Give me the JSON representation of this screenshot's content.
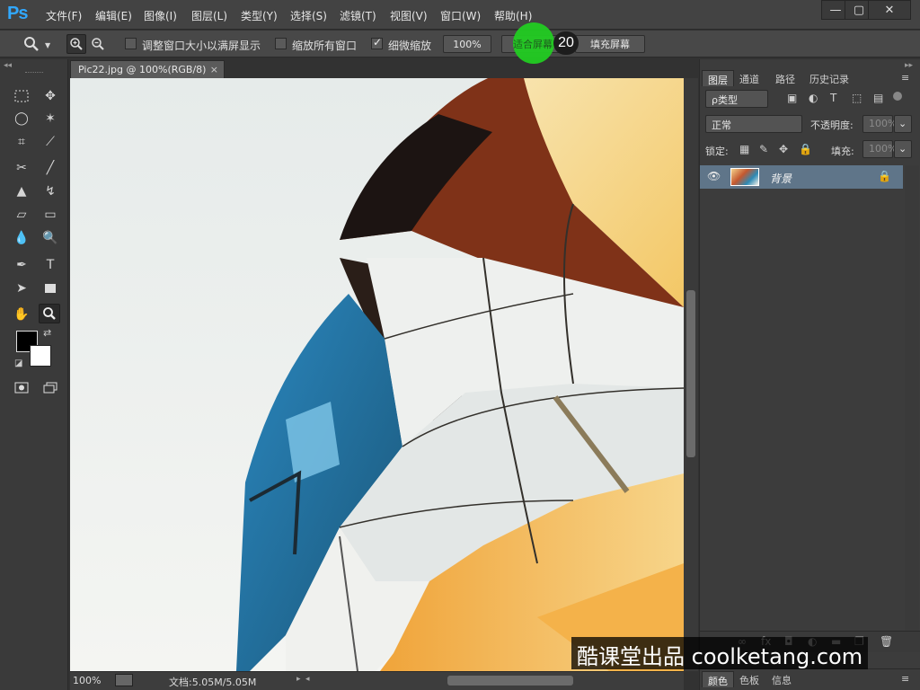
{
  "app": {
    "logo": "Ps"
  },
  "menu": {
    "items": [
      "文件(F)",
      "编辑(E)",
      "图像(I)",
      "图层(L)",
      "类型(Y)",
      "选择(S)",
      "滤镜(T)",
      "视图(V)",
      "窗口(W)",
      "帮助(H)"
    ]
  },
  "window_controls": {
    "minimize": "—",
    "maximize": "▢",
    "close": "✕"
  },
  "options": {
    "resize_window_label": "调整窗口大小以满屏显示",
    "resize_window_checked": false,
    "zoom_all_windows_label": "缩放所有窗口",
    "zoom_all_windows_checked": false,
    "scrubby_zoom_label": "细微缩放",
    "scrubby_zoom_checked": true,
    "btn_100": "100%",
    "btn_fit_screen": "适合屏幕",
    "btn_fill_screen": "填充屏幕"
  },
  "tutorial": {
    "step_number": "20",
    "highlight_color": "#22cc22"
  },
  "document": {
    "tab_title": "Pic22.jpg @ 100%(RGB/8)",
    "close": "×",
    "zoom": "100%",
    "doc_info": "文档:5.05M/5.05M"
  },
  "panels": {
    "tabs": [
      "图层",
      "通道",
      "路径",
      "历史记录"
    ],
    "filter_label": "ρ类型",
    "blend_mode": "正常",
    "opacity_label": "不透明度:",
    "opacity_value": "100%",
    "lock_label": "锁定:",
    "fill_label": "填充:",
    "fill_value": "100%",
    "layer_name": "背景",
    "bottom_tabs": [
      "颜色",
      "色板",
      "信息"
    ]
  },
  "watermark": "酷课堂出品 coolketang.com",
  "colors": {
    "accent": "#31a8ff",
    "layer_selected": "#5f7589"
  }
}
